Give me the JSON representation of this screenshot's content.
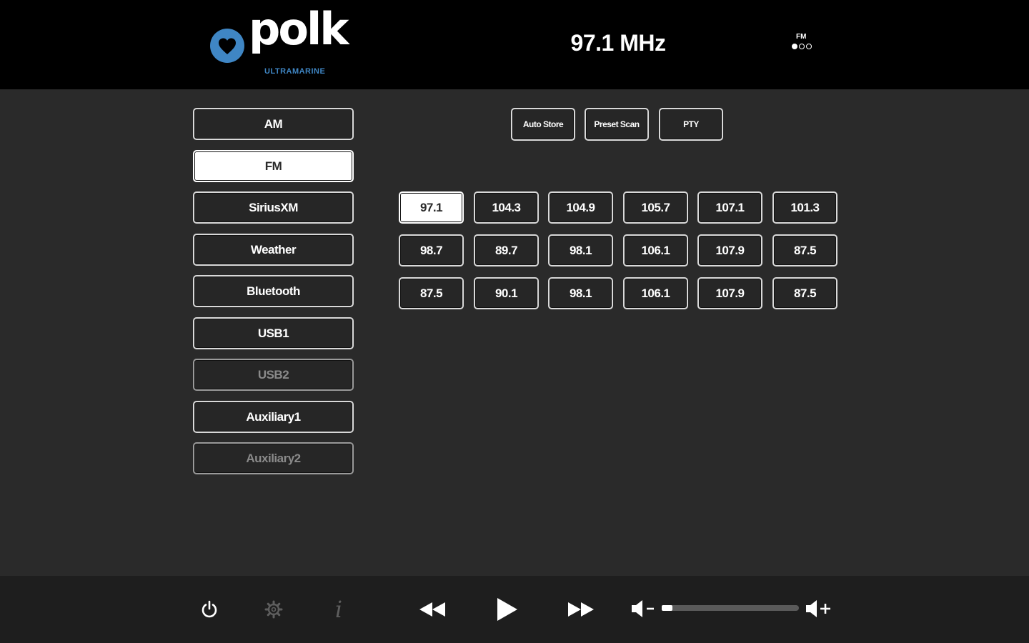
{
  "header": {
    "logo_text": "polk",
    "logo_subtext": "ULTRAMARINE",
    "frequency": "97.1 MHz",
    "band_label": "FM",
    "band_dots": [
      true,
      false,
      false
    ]
  },
  "sources": [
    {
      "label": "AM",
      "state": "normal"
    },
    {
      "label": "FM",
      "state": "selected"
    },
    {
      "label": "SiriusXM",
      "state": "normal"
    },
    {
      "label": "Weather",
      "state": "normal"
    },
    {
      "label": "Bluetooth",
      "state": "normal"
    },
    {
      "label": "USB1",
      "state": "normal"
    },
    {
      "label": "USB2",
      "state": "disabled"
    },
    {
      "label": "Auxiliary1",
      "state": "normal"
    },
    {
      "label": "Auxiliary2",
      "state": "disabled"
    }
  ],
  "tuner_buttons": {
    "auto_store": "Auto Store",
    "preset_scan": "Preset Scan",
    "pty": "PTY"
  },
  "presets": [
    [
      "97.1",
      "104.3",
      "104.9",
      "105.7",
      "107.1",
      "101.3"
    ],
    [
      "98.7",
      "89.7",
      "98.1",
      "106.1",
      "107.9",
      "87.5"
    ],
    [
      "87.5",
      "90.1",
      "98.1",
      "106.1",
      "107.9",
      "87.5"
    ]
  ],
  "selected_preset": "97.1",
  "footer": {
    "icons": [
      "power-icon",
      "settings-icon",
      "info-icon",
      "rewind-icon",
      "play-icon",
      "fast-forward-icon",
      "volume-down-icon",
      "volume-up-icon"
    ],
    "info_glyph": "i",
    "volume_level": 0.08
  },
  "colors": {
    "header_bg": "#000000",
    "body_bg": "#2a2a2a",
    "footer_bg": "#1e1e1e",
    "brand_blue": "#3f86c4",
    "selected_bg": "#ffffff"
  }
}
